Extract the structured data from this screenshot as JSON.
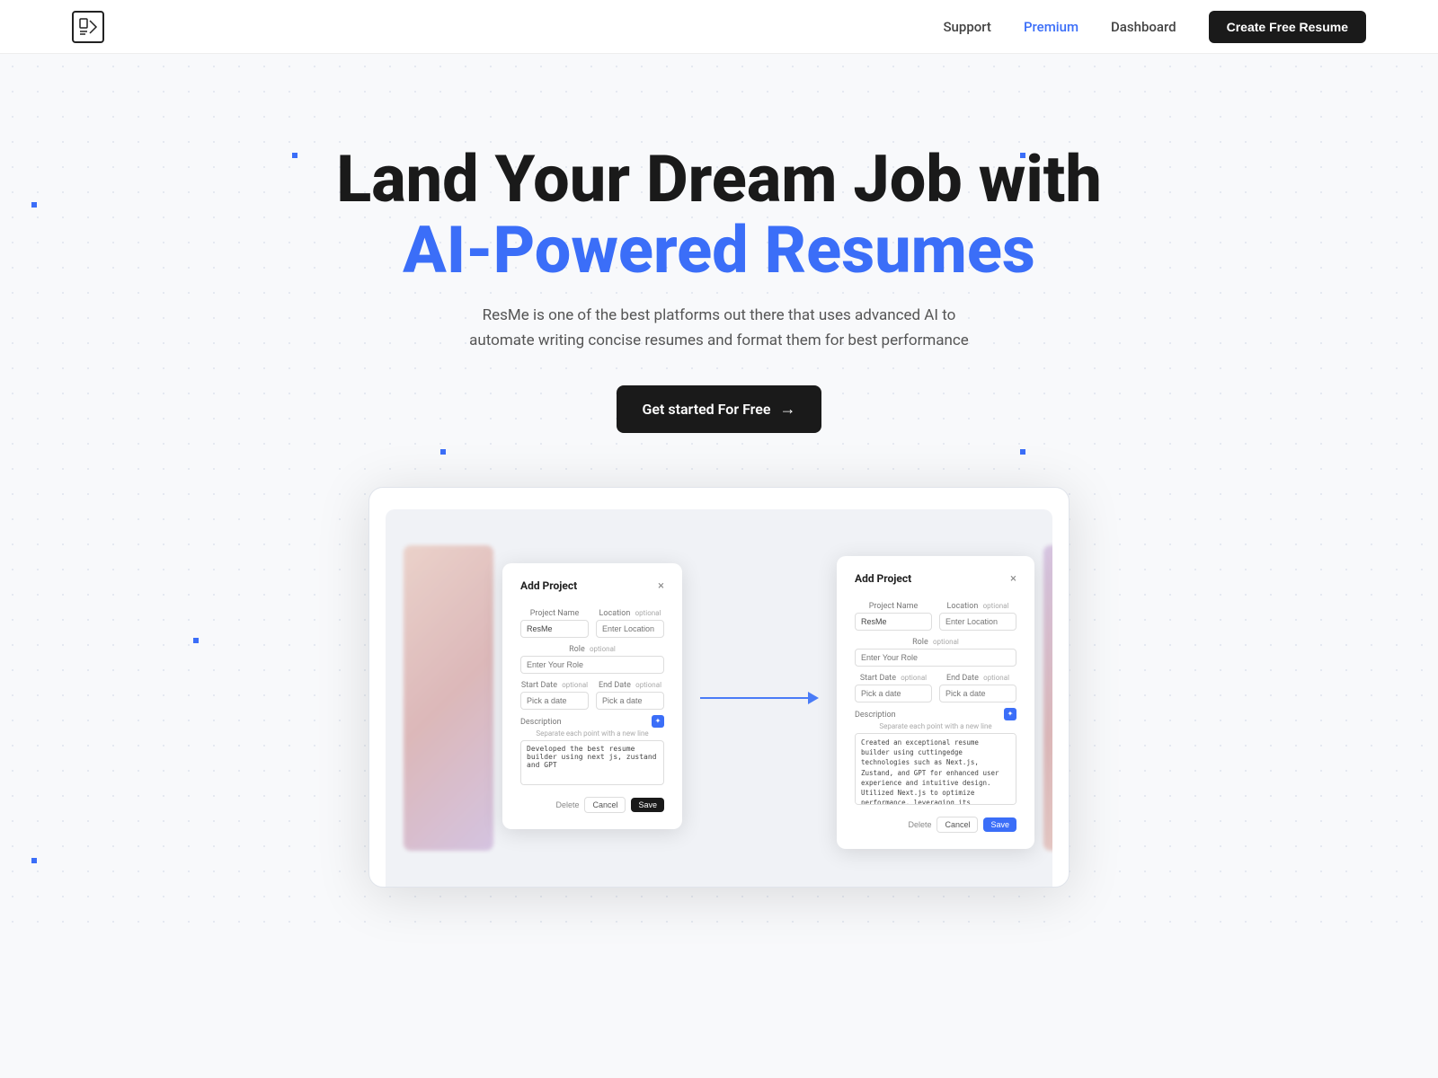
{
  "nav": {
    "logo": "ℝ",
    "links": [
      {
        "label": "Support",
        "active": false
      },
      {
        "label": "Premium",
        "active": true
      },
      {
        "label": "Dashboard",
        "active": false
      }
    ],
    "cta_label": "Create Free Resume"
  },
  "hero": {
    "line1": "Land Your Dream Job with",
    "line2": "AI-Powered Resumes",
    "subtitle": "ResMe is one of the best platforms out there that uses advanced AI to automate writing concise resumes and format them for best performance",
    "cta_label": "Get started For Free"
  },
  "preview": {
    "modal_left": {
      "title": "Add Project",
      "close": "×",
      "project_name_label": "Project Name",
      "project_name_value": "ResMe",
      "location_label": "Location",
      "location_optional": "optional",
      "location_placeholder": "Enter Location",
      "role_label": "Role",
      "role_optional": "optional",
      "role_placeholder": "Enter Your Role",
      "start_date_label": "Start Date",
      "start_date_optional": "optional",
      "start_date_placeholder": "Pick a date",
      "end_date_label": "End Date",
      "end_date_optional": "optional",
      "end_date_placeholder": "Pick a date",
      "description_label": "Description",
      "description_placeholder": "Separate each point with a new line",
      "description_value": "Developed the best resume builder using next js, zustand and GPT",
      "btn_delete": "Delete",
      "btn_cancel": "Cancel",
      "btn_save": "Save"
    },
    "modal_right": {
      "title": "Add Project",
      "close": "×",
      "project_name_label": "Project Name",
      "project_name_value": "ResMe",
      "location_label": "Location",
      "location_optional": "optional",
      "location_placeholder": "Enter Location",
      "role_label": "Role",
      "role_optional": "optional",
      "role_placeholder": "Enter Your Role",
      "start_date_label": "Start Date",
      "start_date_optional": "optional",
      "end_date_label": "End Date",
      "end_date_optional": "optional",
      "start_date_placeholder": "Pick a date",
      "end_date_placeholder": "Pick a date",
      "description_label": "Description",
      "description_placeholder": "Separate each point with a new line",
      "description_value": "Created an exceptional resume builder using cuttingedge technologies such as Next.js, Zustand, and GPT for enhanced user experience and intuitive design.\nUtilized Next.js to optimize performance, leveraging its serverside rendering capabilities and granular clientside routing.\nImplemented Zustand, a state management library, to efficiently manage global application state and ensure seamless data synchronization across components.\nIntegrated GPT (Generative Pretrained Transformer) to enhance the resume building process by utilizing machine learning and natural language processing for intelligent content generation and personalized recommendations.",
      "btn_delete": "Delete",
      "btn_cancel": "Cancel",
      "btn_save": "Save"
    }
  }
}
